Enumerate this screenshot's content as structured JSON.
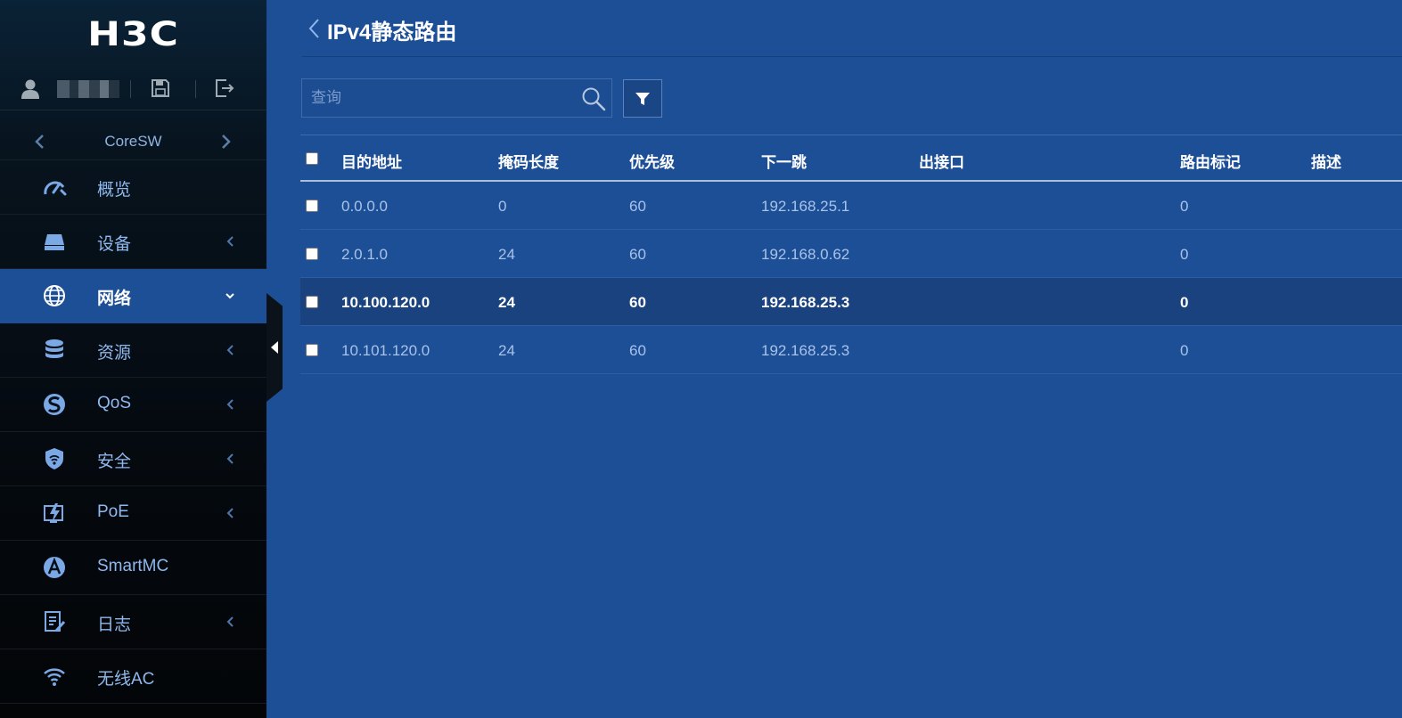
{
  "brand": {
    "logo_text": "H3C"
  },
  "user_bar": {
    "icons": [
      "user-icon",
      "save-icon",
      "logout-icon"
    ]
  },
  "device": {
    "name": "CoreSW"
  },
  "nav": {
    "items": [
      {
        "label": "概览",
        "icon": "gauge-icon",
        "has_caret": false,
        "active": false
      },
      {
        "label": "设备",
        "icon": "device-icon",
        "has_caret": true,
        "active": false
      },
      {
        "label": "网络",
        "icon": "globe-icon",
        "has_caret": true,
        "active": true
      },
      {
        "label": "资源",
        "icon": "database-icon",
        "has_caret": true,
        "active": false
      },
      {
        "label": "QoS",
        "icon": "qos-icon",
        "has_caret": true,
        "active": false
      },
      {
        "label": "安全",
        "icon": "shield-icon",
        "has_caret": true,
        "active": false
      },
      {
        "label": "PoE",
        "icon": "poe-icon",
        "has_caret": true,
        "active": false
      },
      {
        "label": "SmartMC",
        "icon": "smartmc-icon",
        "has_caret": false,
        "active": false
      },
      {
        "label": "日志",
        "icon": "log-icon",
        "has_caret": true,
        "active": false
      },
      {
        "label": "无线AC",
        "icon": "wifi-icon",
        "has_caret": false,
        "active": false
      }
    ]
  },
  "page": {
    "title": "IPv4静态路由"
  },
  "search": {
    "placeholder": "查询",
    "value": ""
  },
  "table": {
    "columns": [
      "目的地址",
      "掩码长度",
      "优先级",
      "下一跳",
      "出接口",
      "路由标记",
      "描述"
    ],
    "rows": [
      {
        "dest": "0.0.0.0",
        "mask": "0",
        "pref": "60",
        "next_hop": "192.168.25.1",
        "iface": "",
        "tag": "0",
        "desc": ""
      },
      {
        "dest": "2.0.1.0",
        "mask": "24",
        "pref": "60",
        "next_hop": "192.168.0.62",
        "iface": "",
        "tag": "0",
        "desc": ""
      },
      {
        "dest": "10.100.120.0",
        "mask": "24",
        "pref": "60",
        "next_hop": "192.168.25.3",
        "iface": "",
        "tag": "0",
        "desc": ""
      },
      {
        "dest": "10.101.120.0",
        "mask": "24",
        "pref": "60",
        "next_hop": "192.168.25.3",
        "iface": "",
        "tag": "0",
        "desc": ""
      }
    ],
    "highlight_row": 2
  },
  "colors": {
    "main_bg": "#1d4f97",
    "sidebar_bg": "#050a10",
    "nav_label": "#8fb8ee",
    "cell_text": "#a9c3e8",
    "highlight_row_bg": "#19427f"
  }
}
